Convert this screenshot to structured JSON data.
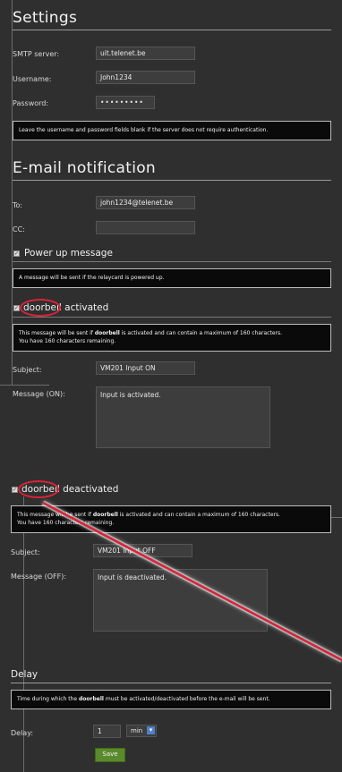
{
  "settings": {
    "title": "Settings",
    "smtp_label": "SMTP server:",
    "smtp_value": "uit.telenet.be",
    "username_label": "Username:",
    "username_value": "John1234",
    "password_label": "Password:",
    "password_value": "•••••••••",
    "note": "Leave the username and password fields blank if the server does not require authentication."
  },
  "email": {
    "title": "E-mail notification",
    "to_label": "To:",
    "to_value": "john1234@telenet.be",
    "cc_label": "CC:",
    "cc_value": ""
  },
  "powerup": {
    "label": "Power up message",
    "note": "A message will be sent if the relaycard is powered up."
  },
  "activated": {
    "label_word": "doorbell",
    "label_rest": " activated",
    "note_a": "This message will be sent if ",
    "note_b": "doorbell",
    "note_c": " is activated and can contain a maximum of 160 characters.",
    "note_d": "You have 160 characters remaining.",
    "subject_label": "Subject:",
    "subject_value": "VM201 Input ON",
    "message_label": "Message (ON):",
    "message_value": "Input is activated."
  },
  "deactivated": {
    "label_word": "doorbell",
    "label_rest": " deactivated",
    "note_a": "This message will be sent if ",
    "note_b": "doorbell",
    "note_c": " is activated and can contain a maximum of 160 characters.",
    "note_d": "You have 160 characters remaining.",
    "subject_label": "Subject:",
    "subject_value": "VM201 Input OFF",
    "message_label": "Message (OFF):",
    "message_value": "Input is deactivated."
  },
  "delay": {
    "title": "Delay",
    "note_a": "Time during which the ",
    "note_b": "doorbell",
    "note_c": " must be activated/deactivated before the e-mail will be sent.",
    "label": "Delay:",
    "value": "1",
    "unit": "min",
    "save_label": "Save"
  },
  "colors": {
    "background": "#2f2f2f",
    "highlight_circle": "#d9233a",
    "save_button": "#5a8a2b"
  }
}
